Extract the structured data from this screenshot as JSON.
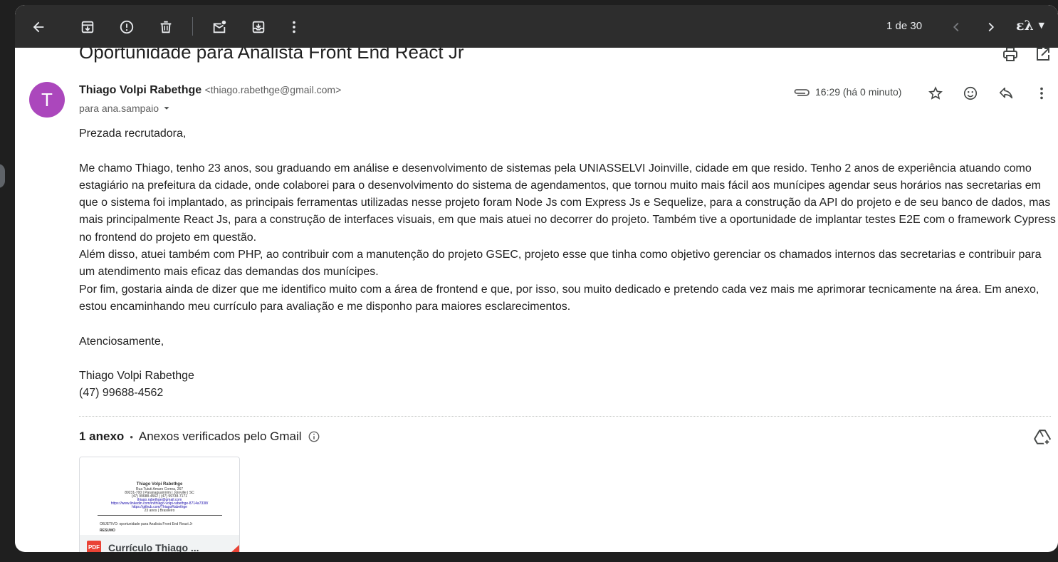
{
  "toolbar": {
    "back_icon": "arrow-back-icon",
    "icons": [
      "archive-icon",
      "report-spam-icon",
      "delete-icon",
      "mark-unread-icon",
      "move-to-icon",
      "more-vert-icon"
    ],
    "counter": "1 de 30",
    "lang_glyph": "ελ"
  },
  "email": {
    "subject": "Oportunidade para Analista Front End React Jr",
    "sender_name": "Thiago Volpi Rabethge",
    "sender_email": "<thiago.rabethge@gmail.com>",
    "avatar_letter": "T",
    "avatar_color": "#ab47bc",
    "recipient": "para ana.sampaio",
    "time": "16:29 (há 0 minuto)",
    "body": {
      "greeting": "Prezada recrutadora,",
      "p1": "Me chamo Thiago, tenho 23 anos, sou graduando em análise e desenvolvimento de sistemas pela UNIASSELVI Joinville, cidade em que resido. Tenho 2 anos de experiência atuando como estagiário na prefeitura da cidade, onde colaborei para o desenvolvimento do sistema de agendamentos, que tornou muito mais fácil aos munícipes agendar seus horários nas secretarias em que o sistema foi implantado, as principais ferramentas utilizadas nesse projeto foram Node Js com Express Js e Sequelize, para a construção da API do projeto e de seu banco de dados, mas mais principalmente React Js, para a construção de interfaces visuais, em que mais atuei no decorrer do projeto. Também tive a oportunidade de implantar testes E2E com o framework Cypress no frontend do projeto em questão.",
      "p2": "Além disso, atuei também com PHP, ao contribuir com a manutenção do projeto GSEC, projeto esse que tinha como objetivo gerenciar os chamados internos das secretarias e contribuir para um atendimento mais eficaz das demandas dos munícipes.",
      "p3": "Por fim, gostaria ainda de dizer que me identifico muito com a área de frontend e que, por isso, sou muito dedicado e pretendo cada vez mais me aprimorar tecnicamente na área. Em anexo, estou encaminhando meu currículo para avaliação e me disponho para maiores esclarecimentos.",
      "closing": "Atenciosamente,",
      "signature_name": "Thiago Volpi Rabethge",
      "signature_phone": "(47) 99688-4562"
    }
  },
  "attachments": {
    "count_label": "1 anexo",
    "separator": "•",
    "verified_label": "Anexos verificados pelo Gmail",
    "file_badge": "PDF",
    "file_name": "Currículo Thiago ...",
    "preview": {
      "name": "Thiago Volpi Rabethge",
      "address": "Rua Tuiuti Amaro Correa, 267",
      "city": "89231-700 | Paranaguamirim | Joinville | SC",
      "phones": "(47) 99688-4562 | (47) 99738-7171",
      "email": "thiago.rabethge@gmail.com",
      "linkedin": "https://www.linkedin.com/in/thiago-volpi-rabethge-8714a7338/",
      "github": "https://github.com/ThiagoRabethge",
      "age": "23 anos | Brasileiro",
      "objective": "OBJETIVO: oportunidade para Analista Front End React Jr",
      "summary_title": "RESUMO"
    }
  }
}
